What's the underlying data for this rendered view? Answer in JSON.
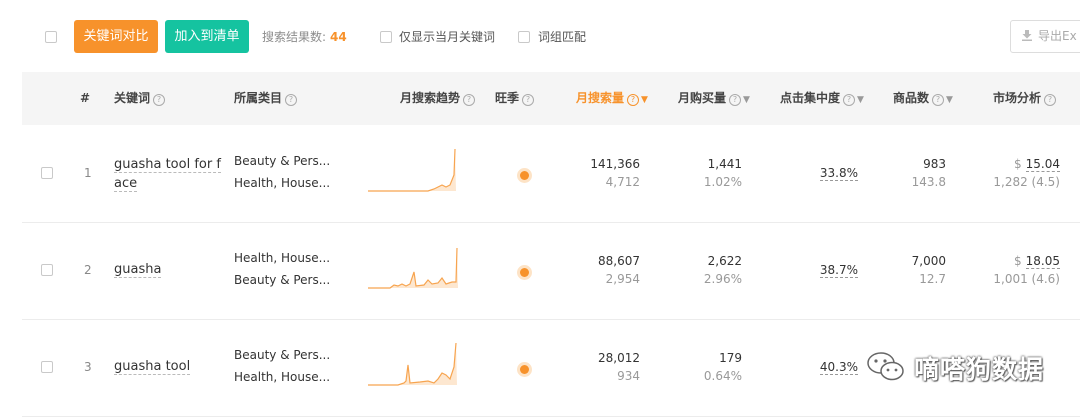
{
  "toolbar": {
    "compare_button": "关键词对比",
    "add_list_button": "加入到清单",
    "result_label": "搜索结果数:",
    "result_count": "44",
    "option_current_month": "仅显示当月关键词",
    "option_phrase_match": "词组匹配",
    "export_label": "导出Ex"
  },
  "table": {
    "headers": {
      "index": "#",
      "keyword": "关键词",
      "category": "所属类目",
      "trend": "月搜索趋势",
      "season": "旺季",
      "monthly_search": "月搜索量",
      "monthly_purchase": "月购买量",
      "click_concentration": "点击集中度",
      "product_count": "商品数",
      "market_analysis": "市场分析"
    },
    "rows": [
      {
        "index": "1",
        "keyword": "guasha tool for face",
        "categories": [
          "Beauty & Pers...",
          "Health, House..."
        ],
        "monthly_search": "141,366",
        "monthly_search_sub": "4,712",
        "monthly_purchase": "1,441",
        "monthly_purchase_sub": "1.02%",
        "click_concentration": "33.8%",
        "product_count": "983",
        "product_count_sub": "143.8",
        "price_currency": "$",
        "price": "15.04",
        "market_sub": "1,282 (4.5)"
      },
      {
        "index": "2",
        "keyword": "guasha",
        "categories": [
          "Health, House...",
          "Beauty & Pers..."
        ],
        "monthly_search": "88,607",
        "monthly_search_sub": "2,954",
        "monthly_purchase": "2,622",
        "monthly_purchase_sub": "2.96%",
        "click_concentration": "38.7%",
        "product_count": "7,000",
        "product_count_sub": "12.7",
        "price_currency": "$",
        "price": "18.05",
        "market_sub": "1,001 (4.6)"
      },
      {
        "index": "3",
        "keyword": "guasha tool",
        "categories": [
          "Beauty & Pers...",
          "Health, House..."
        ],
        "monthly_search": "28,012",
        "monthly_search_sub": "934",
        "monthly_purchase": "179",
        "monthly_purchase_sub": "0.64%",
        "click_concentration": "40.3%",
        "product_count": "",
        "product_count_sub": "",
        "price_currency": "",
        "price": "",
        "market_sub": ""
      }
    ]
  },
  "watermark": {
    "text": "嘀嗒狗数据",
    "icon": "wechat-icon"
  },
  "colors": {
    "accent": "#f7922b",
    "teal": "#15c3a0",
    "trend_line": "#f7a44f",
    "trend_fill": "#fde7d0"
  }
}
